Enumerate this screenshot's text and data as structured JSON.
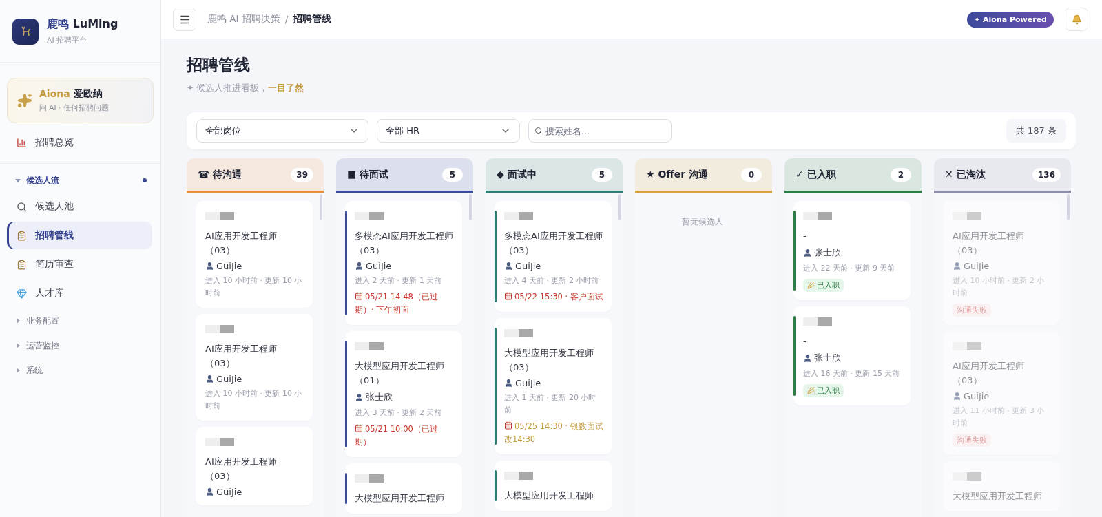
{
  "sidebar": {
    "brand": {
      "title_cn": "鹿鸣",
      "title_en": "LuMing",
      "subtitle": "AI 招聘平台"
    },
    "assistant": {
      "name": "Aiona",
      "name_cn": "爱欧纳",
      "subtitle": "问 AI · 任何招聘问题"
    },
    "nav": [
      {
        "kind": "item",
        "label": "招聘总览",
        "selected": false
      },
      {
        "kind": "group",
        "label": "候选人流",
        "expanded": true,
        "dot": true,
        "children": [
          {
            "label": "候选人池",
            "selected": false
          },
          {
            "label": "招聘管线",
            "selected": true
          },
          {
            "label": "简历审查",
            "selected": false
          },
          {
            "label": "人才库",
            "selected": false
          }
        ]
      },
      {
        "kind": "group",
        "label": "业务配置",
        "expanded": false,
        "dot": false
      },
      {
        "kind": "group",
        "label": "运营监控",
        "expanded": false,
        "dot": false
      },
      {
        "kind": "group",
        "label": "系统",
        "expanded": false,
        "dot": false
      }
    ]
  },
  "header": {
    "breadcrumb": [
      "鹿鸣 AI 招聘决策",
      "招聘管线"
    ],
    "separator": "/",
    "badge": "✦ Aiona Powered"
  },
  "page": {
    "title": "招聘管线",
    "subtitle": "✦ 候选人推进看板，",
    "subtitle_highlight": "一目了然"
  },
  "filters": {
    "selects": [
      "全部岗位",
      "全部 HR"
    ],
    "search": {
      "placeholder": "搜索姓名..."
    },
    "count": "共 187 条"
  },
  "columns": [
    {
      "symbol": "☎",
      "title": "待沟通",
      "count": "39",
      "color": "#e8903a",
      "card_bar": false,
      "faded": false,
      "cards": [
        {
          "job": "AI应用开发工程师（03）",
          "hr": "GuiJie",
          "times": "进入 10 小时前 · 更新 10 小时前"
        },
        {
          "job": "AI应用开发工程师（03）",
          "hr": "GuiJie",
          "times": "进入 10 小时前 · 更新 10 小时前"
        },
        {
          "job": "AI应用开发工程师（03）",
          "hr": "GuiJie"
        }
      ]
    },
    {
      "symbol": "■",
      "title": "待面试",
      "count": "5",
      "color": "#3b4a9a",
      "card_bar": true,
      "faded": false,
      "cards": [
        {
          "job": "多模态AI应用开发工程师（03）",
          "hr": "GuiJie",
          "times": "进入 2 天前 · 更新 1 天前",
          "schedule": {
            "text": "05/21 14:48（已过期）· 下午初面",
            "kind": "overdue"
          }
        },
        {
          "job": "大模型应用开发工程师（01）",
          "hr": "张士欣",
          "times": "进入 3 天前 · 更新 2 天前",
          "schedule": {
            "text": "05/21 10:00（已过期）",
            "kind": "overdue"
          }
        },
        {
          "job": "大模型应用开发工程师"
        }
      ]
    },
    {
      "symbol": "◆",
      "title": "面试中",
      "count": "5",
      "color": "#2f7d73",
      "card_bar": true,
      "faded": false,
      "cards": [
        {
          "job": "多模态AI应用开发工程师（03）",
          "hr": "GuiJie",
          "times": "进入 4 天前 · 更新 2 小时前",
          "schedule": {
            "text": "05/22 15:30 · 客户面试",
            "kind": "overdue"
          }
        },
        {
          "job": "大模型应用开发工程师（03）",
          "hr": "GuiJie",
          "times": "进入 1 天前 · 更新 20 小时前",
          "schedule": {
            "text": "05/25 14:30 · 银数面试改14:30",
            "kind": "upcoming"
          }
        },
        {
          "job": "大模型应用开发工程师"
        }
      ]
    },
    {
      "symbol": "★",
      "title": "Offer 沟通",
      "count": "0",
      "color": "#d4a53c",
      "empty": "暂无候选人"
    },
    {
      "symbol": "✓",
      "title": "已入职",
      "count": "2",
      "color": "#2e7d46",
      "card_bar": true,
      "faded": false,
      "cards": [
        {
          "job": "-",
          "hr": "张士欣",
          "times": "进入 22 天前 · 更新 9 天前",
          "tag": {
            "text": "已入职",
            "kind": "hired"
          }
        },
        {
          "job": "-",
          "hr": "张士欣",
          "times": "进入 16 天前 · 更新 15 天前",
          "tag": {
            "text": "已入职",
            "kind": "hired"
          }
        }
      ]
    },
    {
      "symbol": "✕",
      "title": "已淘汰",
      "count": "136",
      "color": "#8e8fa8",
      "card_bar": false,
      "faded": true,
      "cards": [
        {
          "job": "AI应用开发工程师（03）",
          "hr": "GuiJie",
          "times": "进入 10 小时前 · 更新 2 小时前",
          "tag": {
            "text": "沟通失败",
            "kind": "failed"
          }
        },
        {
          "job": "AI应用开发工程师（03）",
          "hr": "GuiJie",
          "times": "进入 11 小时前 · 更新 3 小时前",
          "tag": {
            "text": "沟通失败",
            "kind": "failed"
          }
        },
        {
          "job": "大模型应用开发工程师"
        }
      ]
    }
  ]
}
